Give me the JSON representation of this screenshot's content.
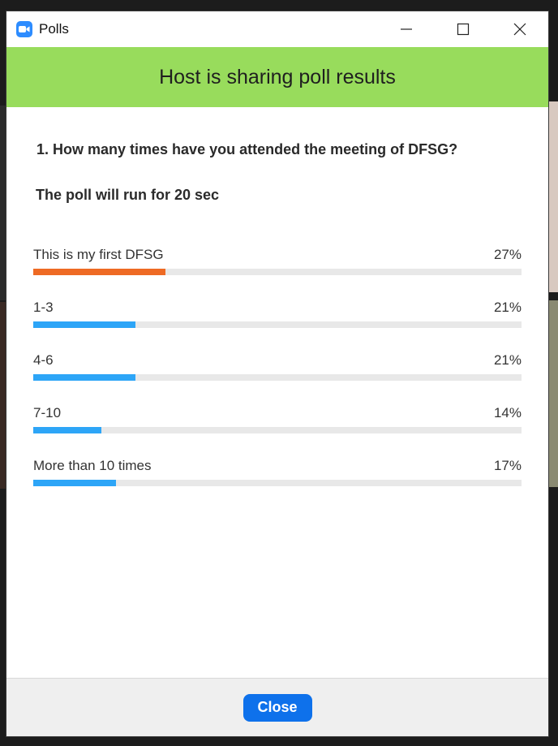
{
  "window": {
    "title": "Polls"
  },
  "banner": {
    "text": "Host is sharing poll results"
  },
  "poll": {
    "question": "1. How many times have you attended the meeting of DFSG?",
    "timer": "The poll will run for 20 sec",
    "options": [
      {
        "label": "This is my first DFSG",
        "percent_text": "27%",
        "percent": 27,
        "leading": true
      },
      {
        "label": "1-3",
        "percent_text": "21%",
        "percent": 21,
        "leading": false
      },
      {
        "label": "4-6",
        "percent_text": "21%",
        "percent": 21,
        "leading": false
      },
      {
        "label": "7-10",
        "percent_text": "14%",
        "percent": 14,
        "leading": false
      },
      {
        "label": "More than 10 times",
        "percent_text": "17%",
        "percent": 17,
        "leading": false
      }
    ]
  },
  "footer": {
    "close_label": "Close"
  },
  "colors": {
    "banner": "#98dc5c",
    "bar_leading": "#ee6a24",
    "bar_default": "#2da5f7",
    "track": "#e8e8e8",
    "close_button": "#0e71eb"
  },
  "icons": {
    "app": "zoom-camera-icon",
    "minimize": "minimize-icon",
    "maximize": "maximize-icon",
    "close": "close-icon"
  }
}
